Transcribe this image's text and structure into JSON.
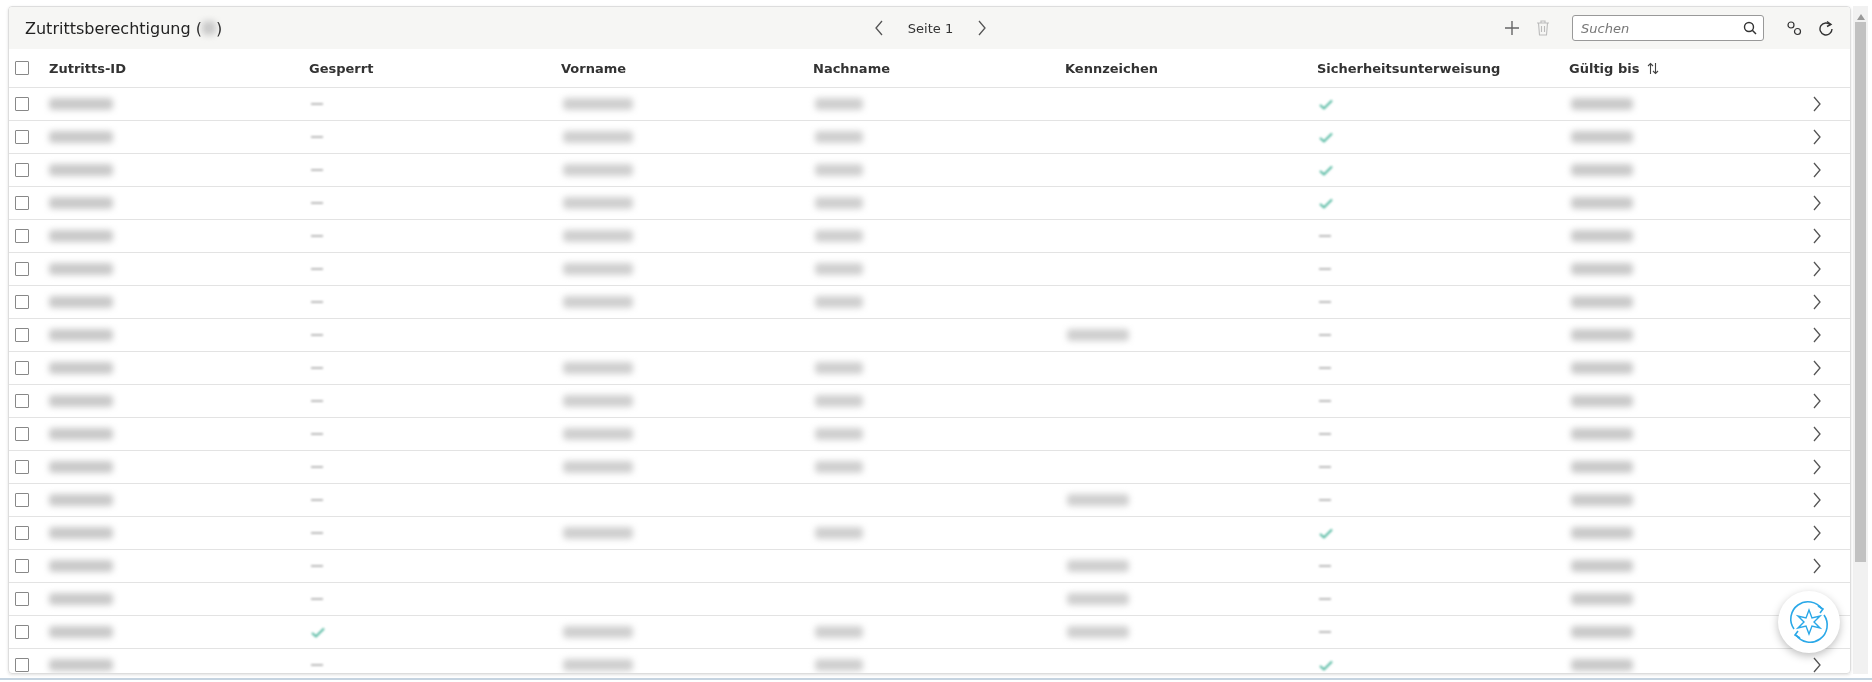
{
  "header": {
    "title": "Zutrittsberechtigung (",
    "title_end": ")",
    "page_label": "Seite 1",
    "search": {
      "placeholder": "Suchen"
    }
  },
  "table": {
    "select_all_checked": false,
    "columns": [
      {
        "label": "Zutritts-ID"
      },
      {
        "label": "Gesperrt"
      },
      {
        "label": "Vorname"
      },
      {
        "label": "Nachname"
      },
      {
        "label": "Kennzeichen"
      },
      {
        "label": "Sicherheitsunterweisung"
      },
      {
        "label": "Gültig bis",
        "sortable": true
      }
    ],
    "rows": [
      {
        "checked": false,
        "locked": false,
        "first_name": true,
        "last_name": true,
        "plate": false,
        "instructed": true,
        "chevron": true
      },
      {
        "checked": false,
        "locked": false,
        "first_name": true,
        "last_name": true,
        "plate": false,
        "instructed": true,
        "chevron": true
      },
      {
        "checked": false,
        "locked": false,
        "first_name": true,
        "last_name": true,
        "plate": false,
        "instructed": true,
        "chevron": true
      },
      {
        "checked": false,
        "locked": false,
        "first_name": true,
        "last_name": true,
        "plate": false,
        "instructed": true,
        "chevron": true
      },
      {
        "checked": false,
        "locked": false,
        "first_name": true,
        "last_name": true,
        "plate": false,
        "instructed": false,
        "chevron": true
      },
      {
        "checked": false,
        "locked": false,
        "first_name": true,
        "last_name": true,
        "plate": false,
        "instructed": false,
        "chevron": true
      },
      {
        "checked": false,
        "locked": false,
        "first_name": true,
        "last_name": true,
        "plate": false,
        "instructed": false,
        "chevron": true
      },
      {
        "checked": false,
        "locked": false,
        "first_name": false,
        "last_name": false,
        "plate": true,
        "instructed": false,
        "chevron": true
      },
      {
        "checked": false,
        "locked": false,
        "first_name": true,
        "last_name": true,
        "plate": false,
        "instructed": false,
        "chevron": true
      },
      {
        "checked": false,
        "locked": false,
        "first_name": true,
        "last_name": true,
        "plate": false,
        "instructed": false,
        "chevron": true
      },
      {
        "checked": false,
        "locked": false,
        "first_name": true,
        "last_name": true,
        "plate": false,
        "instructed": false,
        "chevron": true
      },
      {
        "checked": false,
        "locked": false,
        "first_name": true,
        "last_name": true,
        "plate": false,
        "instructed": false,
        "chevron": true
      },
      {
        "checked": false,
        "locked": false,
        "first_name": false,
        "last_name": false,
        "plate": true,
        "instructed": false,
        "chevron": true
      },
      {
        "checked": false,
        "locked": false,
        "first_name": true,
        "last_name": true,
        "plate": false,
        "instructed": true,
        "chevron": true
      },
      {
        "checked": false,
        "locked": false,
        "first_name": false,
        "last_name": false,
        "plate": true,
        "instructed": false,
        "chevron": true
      },
      {
        "checked": false,
        "locked": false,
        "first_name": false,
        "last_name": false,
        "plate": true,
        "instructed": false,
        "chevron": false
      },
      {
        "checked": false,
        "locked": true,
        "first_name": true,
        "last_name": true,
        "plate": true,
        "instructed": false,
        "chevron": false
      },
      {
        "checked": false,
        "locked": false,
        "first_name": true,
        "last_name": true,
        "plate": false,
        "instructed": true,
        "chevron": true
      }
    ]
  }
}
